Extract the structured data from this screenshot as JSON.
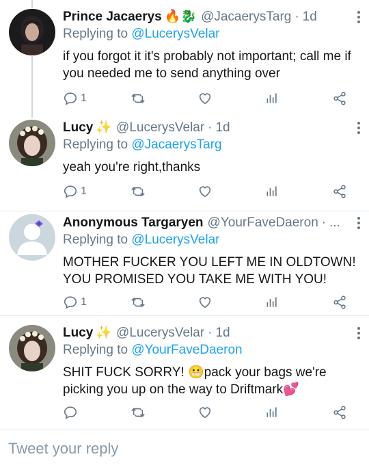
{
  "tweets": [
    {
      "name": "Prince Jacaerys",
      "emoji": "🔥🐉",
      "handle": "@JacaerysTarg",
      "time": "1d",
      "reply_prefix": "Replying to ",
      "reply_to": "@LucerysVelar",
      "text": "if you forgot it it's probably not important; call me if you needed me to send anything over",
      "reply_count": "1",
      "avatar": "dark-hair-man-avatar"
    },
    {
      "name": "Lucy",
      "emoji": "✨",
      "handle": "@LucerysVelar",
      "time": "1d",
      "reply_prefix": "Replying to ",
      "reply_to": "@JacaerysTarg",
      "text": "yeah you're right,thanks",
      "reply_count": "1",
      "avatar": "flower-crown-avatar"
    },
    {
      "name": "Anonymous Targaryen",
      "emoji": "",
      "handle": "@YourFaveDaeron",
      "time": "...",
      "reply_prefix": "Replying to ",
      "reply_to": "@LucerysVelar",
      "text": "MOTHER FUCKER YOU LEFT ME IN OLDTOWN! YOU PROMISED YOU TAKE ME WITH YOU!",
      "reply_count": "1",
      "avatar": "default-avatar-with-bow"
    },
    {
      "name": "Lucy",
      "emoji": "✨",
      "handle": "@LucerysVelar",
      "time": "1d",
      "reply_prefix": "Replying to ",
      "reply_to": "@YourFaveDaeron",
      "text": "SHIT FUCK SORRY! 😬pack your bags we're picking you up on the way to Driftmark💕",
      "reply_count": "",
      "avatar": "flower-crown-avatar"
    }
  ],
  "compose": {
    "placeholder": "Tweet your reply"
  },
  "colors": {
    "link": "#1da1f2",
    "secondary": "#657786",
    "divider": "#e1e8ed"
  }
}
